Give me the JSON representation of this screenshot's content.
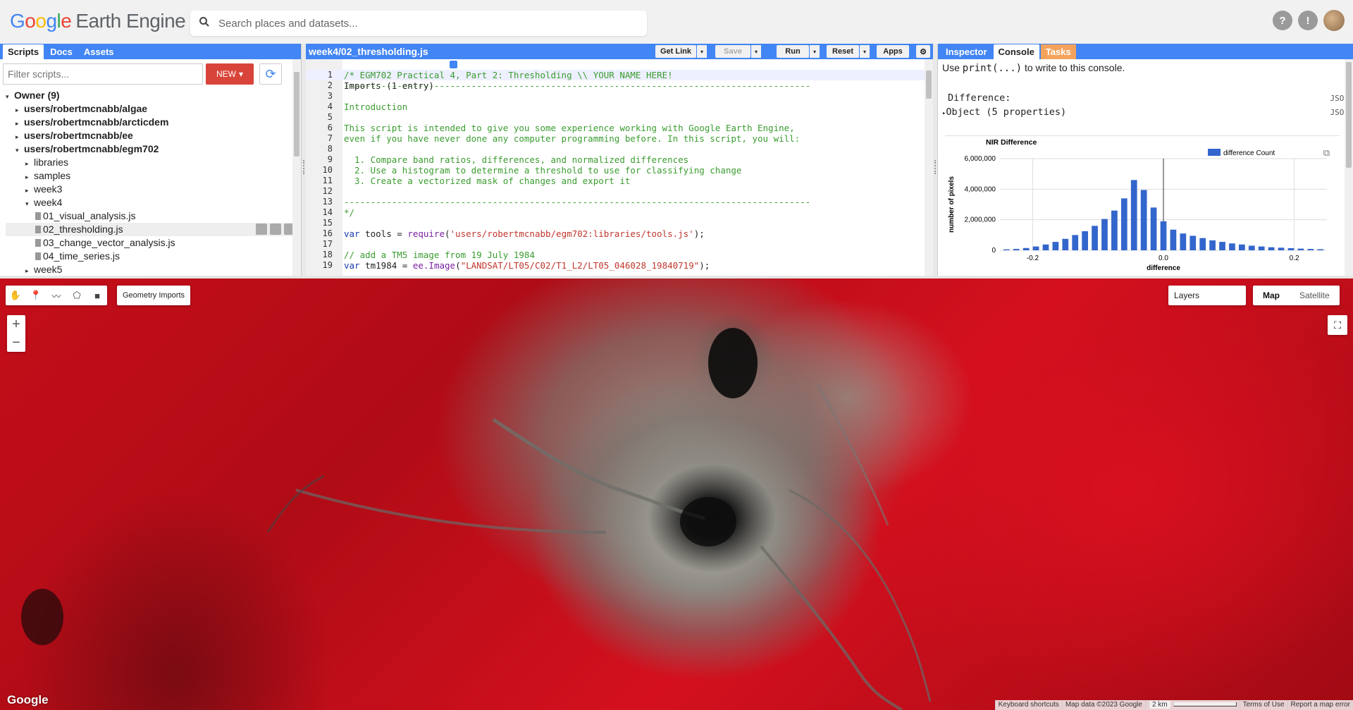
{
  "app": {
    "logo": {
      "google": [
        "G",
        "o",
        "o",
        "g",
        "l",
        "e"
      ],
      "product": "Earth Engine"
    },
    "search_placeholder": "Search places and datasets...",
    "top_icons": [
      "help-icon",
      "feedback-icon",
      "avatar"
    ]
  },
  "left_panel": {
    "tabs": [
      "Scripts",
      "Docs",
      "Assets"
    ],
    "filter_placeholder": "Filter scripts...",
    "new_label": "NEW",
    "tree": [
      {
        "label": "Owner (9)",
        "bold": true,
        "caret": "▾",
        "indent": 0
      },
      {
        "label": "users/robertmcnabb/algae",
        "bold": true,
        "caret": "▸",
        "indent": 1
      },
      {
        "label": "users/robertmcnabb/arcticdem",
        "bold": true,
        "caret": "▸",
        "indent": 1
      },
      {
        "label": "users/robertmcnabb/ee",
        "bold": true,
        "caret": "▸",
        "indent": 1
      },
      {
        "label": "users/robertmcnabb/egm702",
        "bold": true,
        "caret": "▾",
        "indent": 1
      },
      {
        "label": "libraries",
        "caret": "▸",
        "indent": 2
      },
      {
        "label": "samples",
        "caret": "▸",
        "indent": 2
      },
      {
        "label": "week3",
        "caret": "▸",
        "indent": 2
      },
      {
        "label": "week4",
        "caret": "▾",
        "indent": 2
      },
      {
        "label": "01_visual_analysis.js",
        "file": true,
        "indent": 3
      },
      {
        "label": "02_thresholding.js",
        "file": true,
        "indent": 3,
        "selected": true
      },
      {
        "label": "03_change_vector_analysis.js",
        "file": true,
        "indent": 3
      },
      {
        "label": "04_time_series.js",
        "file": true,
        "indent": 3
      },
      {
        "label": "week5",
        "caret": "▸",
        "indent": 2
      }
    ]
  },
  "code_panel": {
    "title": "week4/02_thresholding.js",
    "buttons": {
      "get_link": "Get Link",
      "save": "Save",
      "run": "Run",
      "reset": "Reset",
      "apps": "Apps"
    },
    "imports": "Imports (1 entry)",
    "lines": [
      {
        "n": "1",
        "html": "<span class='cm'>/* EGM702 Practical 4, Part 2: Thresholding \\\\ YOUR NAME HERE!</span>",
        "active": true
      },
      {
        "n": "2",
        "html": "<span class='cm'>----------------------------------------------------------------------------------------</span>"
      },
      {
        "n": "3",
        "html": ""
      },
      {
        "n": "4",
        "html": "<span class='cm'>Introduction</span>"
      },
      {
        "n": "5",
        "html": ""
      },
      {
        "n": "6",
        "html": "<span class='cm'>This script is intended to give you some experience working with Google Earth Engine,</span>"
      },
      {
        "n": "7",
        "html": "<span class='cm'>even if you have never done any computer programming before. In this script, you will:</span>"
      },
      {
        "n": "8",
        "html": ""
      },
      {
        "n": "9",
        "html": "<span class='cm'>  1. Compare band ratios, differences, and normalized differences</span>"
      },
      {
        "n": "10",
        "html": "<span class='cm'>  2. Use a histogram to determine a threshold to use for classifying change</span>"
      },
      {
        "n": "11",
        "html": "<span class='cm'>  3. Create a vectorized mask of changes and export it</span>"
      },
      {
        "n": "12",
        "html": ""
      },
      {
        "n": "13",
        "html": "<span class='cm'>----------------------------------------------------------------------------------------</span>"
      },
      {
        "n": "14",
        "html": "<span class='cm'>*/</span>"
      },
      {
        "n": "15",
        "html": ""
      },
      {
        "n": "16",
        "html": "<span class='kw'>var</span> tools = <span class='fn'>require</span>(<span class='st'>'users/robertmcnabb/egm702:libraries/tools.js'</span>);"
      },
      {
        "n": "17",
        "html": ""
      },
      {
        "n": "18",
        "html": "<span class='cm'>// add a TM5 image from 19 July 1984</span>"
      },
      {
        "n": "19",
        "html": "<span class='kw'>var</span> tm1984 = <span class='fn'>ee.Image</span>(<span class='st'>\"LANDSAT/LT05/C02/T1_L2/LT05_046028_19840719\"</span>);"
      }
    ]
  },
  "right_panel": {
    "tabs": [
      "Inspector",
      "Console",
      "Tasks"
    ],
    "hint_pre": "Use ",
    "hint_code": "print(...)",
    "hint_post": " to write to this console.",
    "entries": [
      {
        "label": "Difference:",
        "type": "JSON"
      },
      {
        "label": "Object (5 properties)",
        "type": "JSON"
      }
    ]
  },
  "chart_data": {
    "type": "bar",
    "title": "NIR Difference",
    "xlabel": "difference",
    "ylabel": "number of pixels",
    "legend": "difference Count",
    "xlim": [
      -0.25,
      0.25
    ],
    "ylim": [
      0,
      6000000
    ],
    "yticks": [
      "0",
      "2,000,000",
      "4,000,000",
      "6,000,000"
    ],
    "xticks": [
      "-0.2",
      "0.0",
      "0.2"
    ],
    "bin_centers": [
      -0.24,
      -0.225,
      -0.21,
      -0.195,
      -0.18,
      -0.165,
      -0.15,
      -0.135,
      -0.12,
      -0.105,
      -0.09,
      -0.075,
      -0.06,
      -0.045,
      -0.03,
      -0.015,
      0.0,
      0.015,
      0.03,
      0.045,
      0.06,
      0.075,
      0.09,
      0.105,
      0.12,
      0.135,
      0.15,
      0.165,
      0.18,
      0.195,
      0.21,
      0.225,
      0.24
    ],
    "values": [
      60000,
      90000,
      150000,
      250000,
      380000,
      550000,
      750000,
      1000000,
      1250000,
      1600000,
      2050000,
      2600000,
      3400000,
      4600000,
      3950000,
      2800000,
      1900000,
      1350000,
      1100000,
      950000,
      800000,
      650000,
      550000,
      450000,
      380000,
      300000,
      250000,
      200000,
      170000,
      140000,
      110000,
      90000,
      70000
    ]
  },
  "map": {
    "toolbar": [
      "pan-hand-icon",
      "marker-icon",
      "line-icon",
      "polygon-icon",
      "rectangle-icon"
    ],
    "geometry_imports": "Geometry Imports",
    "zoom_in": "+",
    "zoom_out": "−",
    "layers": "Layers",
    "map_type": [
      "Map",
      "Satellite"
    ],
    "google_logo": "Google",
    "attribution": [
      "Keyboard shortcuts",
      "Map data ©2023 Google",
      "2 km",
      "Terms of Use",
      "Report a map error"
    ]
  }
}
